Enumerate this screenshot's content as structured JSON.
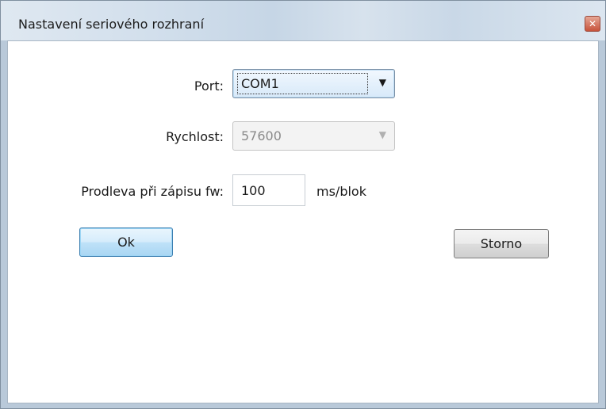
{
  "window": {
    "title": "Nastavení seriového rozhraní",
    "close_glyph": "✕"
  },
  "form": {
    "port": {
      "label": "Port:",
      "value": "COM1"
    },
    "rychlost": {
      "label": "Rychlost:",
      "value": "57600"
    },
    "prodleva": {
      "label": "Prodleva při zápisu fw:",
      "value": "100",
      "unit": "ms/blok"
    }
  },
  "buttons": {
    "ok_label": "Ok",
    "storno_label": "Storno"
  },
  "icons": {
    "dropdown_arrow": "▼"
  }
}
